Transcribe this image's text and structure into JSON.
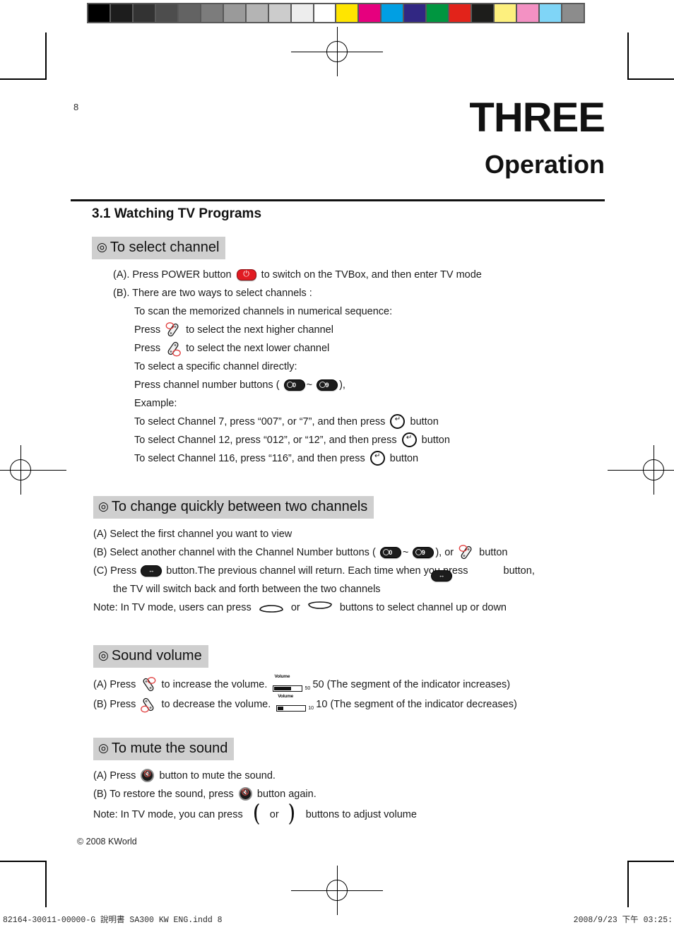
{
  "page": {
    "number": "8",
    "chapter_word": "THREE",
    "chapter_subtitle": "Operation",
    "copyright": "© 2008 KWorld"
  },
  "section_title": "3.1 Watching TV Programs",
  "calibration": {
    "gray_swatches": [
      "#000000",
      "#1d1d1d",
      "#333333",
      "#4d4d4d",
      "#636363",
      "#7c7c7c",
      "#9a9a9a",
      "#b4b4b4",
      "#cccccc",
      "#ededed",
      "#ffffff"
    ],
    "color_swatches": [
      "#ffe500",
      "#e6007e",
      "#009fe3",
      "#312783",
      "#009640",
      "#e2231a",
      "#1d1d1b",
      "#fdf07e",
      "#f391c3",
      "#7fd5f7",
      "#8c8c8c"
    ]
  },
  "blocks": [
    {
      "heading": "To select channel",
      "lines": [
        {
          "indent": "a",
          "parts": [
            {
              "t": "text",
              "v": "(A). Press POWER button"
            },
            {
              "t": "icon",
              "v": "power-key"
            },
            {
              "t": "text",
              "v": "to switch on the TVBox, and then enter TV mode"
            }
          ]
        },
        {
          "indent": "a",
          "parts": [
            {
              "t": "text",
              "v": "(B). There are two ways to select channels :"
            }
          ]
        },
        {
          "indent": "b",
          "parts": [
            {
              "t": "text",
              "v": "To scan the memorized channels in numerical sequence:"
            }
          ]
        },
        {
          "indent": "b",
          "parts": [
            {
              "t": "text",
              "v": "Press"
            },
            {
              "t": "icon",
              "v": "channel-up-key"
            },
            {
              "t": "text",
              "v": "to select the next higher channel"
            }
          ]
        },
        {
          "indent": "b",
          "parts": [
            {
              "t": "text",
              "v": "Press"
            },
            {
              "t": "icon",
              "v": "channel-down-key"
            },
            {
              "t": "text",
              "v": "to select the next lower channel"
            }
          ]
        },
        {
          "indent": "b",
          "parts": [
            {
              "t": "text",
              "v": "To select a specific channel directly:"
            }
          ]
        },
        {
          "indent": "b",
          "parts": [
            {
              "t": "text",
              "v": "Press channel number buttons ("
            },
            {
              "t": "num",
              "v": "0"
            },
            {
              "t": "text",
              "v": "~"
            },
            {
              "t": "num",
              "v": "9"
            },
            {
              "t": "text",
              "v": "),"
            }
          ]
        },
        {
          "indent": "b",
          "parts": [
            {
              "t": "text",
              "v": "Example:"
            }
          ]
        },
        {
          "indent": "b",
          "parts": [
            {
              "t": "text",
              "v": "To select Channel 7, press “007”, or “7”, and then press"
            },
            {
              "t": "icon",
              "v": "enter-key"
            },
            {
              "t": "text",
              "v": "button"
            }
          ]
        },
        {
          "indent": "b",
          "parts": [
            {
              "t": "text",
              "v": "To select Channel 12, press “012”, or “12”, and then press"
            },
            {
              "t": "icon",
              "v": "enter-key"
            },
            {
              "t": "text",
              "v": "button"
            }
          ]
        },
        {
          "indent": "b",
          "parts": [
            {
              "t": "text",
              "v": "To select Channel 116, press “116”, and then press"
            },
            {
              "t": "icon",
              "v": "enter-key"
            },
            {
              "t": "text",
              "v": "button"
            }
          ]
        }
      ]
    },
    {
      "heading": "To change quickly between two channels",
      "lines": [
        {
          "indent": "c",
          "parts": [
            {
              "t": "text",
              "v": "(A) Select the first channel you want to view"
            }
          ]
        },
        {
          "indent": "c",
          "parts": [
            {
              "t": "text",
              "v": "(B) Select another channel with the Channel Number buttons ("
            },
            {
              "t": "num",
              "v": "0"
            },
            {
              "t": "text",
              "v": "~"
            },
            {
              "t": "num",
              "v": "9"
            },
            {
              "t": "text",
              "v": "), or"
            },
            {
              "t": "icon",
              "v": "channel-up-key"
            },
            {
              "t": "text",
              "v": "button"
            }
          ]
        },
        {
          "indent": "c",
          "parts": [
            {
              "t": "text",
              "v": "(C) Press"
            },
            {
              "t": "icon",
              "v": "swap-key"
            },
            {
              "t": "text",
              "v": "button.The previous channel will return. Each time when you press"
            },
            {
              "t": "spacer",
              "v": ""
            },
            {
              "t": "text",
              "v": "button,"
            }
          ]
        },
        {
          "indent": "d",
          "parts": [
            {
              "t": "text",
              "v": "the TV will switch back and forth between the two channels"
            },
            {
              "t": "float-swap",
              "v": "swap-key"
            }
          ]
        },
        {
          "indent": "c",
          "parts": [
            {
              "t": "text",
              "v": "Note: In TV mode, users can press"
            },
            {
              "t": "icon",
              "v": "rocker-up"
            },
            {
              "t": "text",
              "v": "or"
            },
            {
              "t": "icon",
              "v": "rocker-down"
            },
            {
              "t": "text",
              "v": "buttons to select channel up or down"
            }
          ]
        }
      ]
    },
    {
      "heading": "Sound volume",
      "lines": [
        {
          "indent": "c",
          "parts": [
            {
              "t": "text",
              "v": "(A) Press"
            },
            {
              "t": "icon",
              "v": "volume-up-key"
            },
            {
              "t": "text",
              "v": "to increase the volume."
            },
            {
              "t": "meter",
              "v": "meter0"
            },
            {
              "t": "text",
              "v": "50 (The segment of the indicator increases)"
            }
          ]
        },
        {
          "indent": "c",
          "parts": [
            {
              "t": "text",
              "v": "(B) Press"
            },
            {
              "t": "icon",
              "v": "volume-down-key"
            },
            {
              "t": "text",
              "v": "to decrease the volume."
            },
            {
              "t": "meter",
              "v": "meter1"
            },
            {
              "t": "text",
              "v": "10 (The segment of the indicator decreases)"
            }
          ]
        }
      ]
    },
    {
      "heading": "To mute the sound",
      "lines": [
        {
          "indent": "c",
          "parts": [
            {
              "t": "text",
              "v": "(A) Press"
            },
            {
              "t": "icon",
              "v": "mute-key"
            },
            {
              "t": "text",
              "v": "button to mute the sound."
            }
          ]
        },
        {
          "indent": "c",
          "parts": [
            {
              "t": "text",
              "v": "(B) To restore the sound, press"
            },
            {
              "t": "icon",
              "v": "mute-key"
            },
            {
              "t": "text",
              "v": "button again."
            }
          ]
        },
        {
          "indent": "c",
          "parts": [
            {
              "t": "text",
              "v": "Note: In TV mode, you can press"
            },
            {
              "t": "icon",
              "v": "vol-rocker-up"
            },
            {
              "t": "text",
              "v": "or"
            },
            {
              "t": "icon",
              "v": "vol-rocker-down"
            },
            {
              "t": "text",
              "v": "buttons to adjust volume"
            }
          ]
        }
      ]
    }
  ],
  "meters": {
    "meter0": {
      "label": "Volume",
      "value": "50",
      "percent": 60
    },
    "meter1": {
      "label": "Volume",
      "value": "10",
      "percent": 20
    }
  },
  "slug": {
    "left": "82164-30011-00000-G 說明書 SA300 KW ENG.indd    8",
    "right": "2008/9/23   下午 03:25:"
  }
}
